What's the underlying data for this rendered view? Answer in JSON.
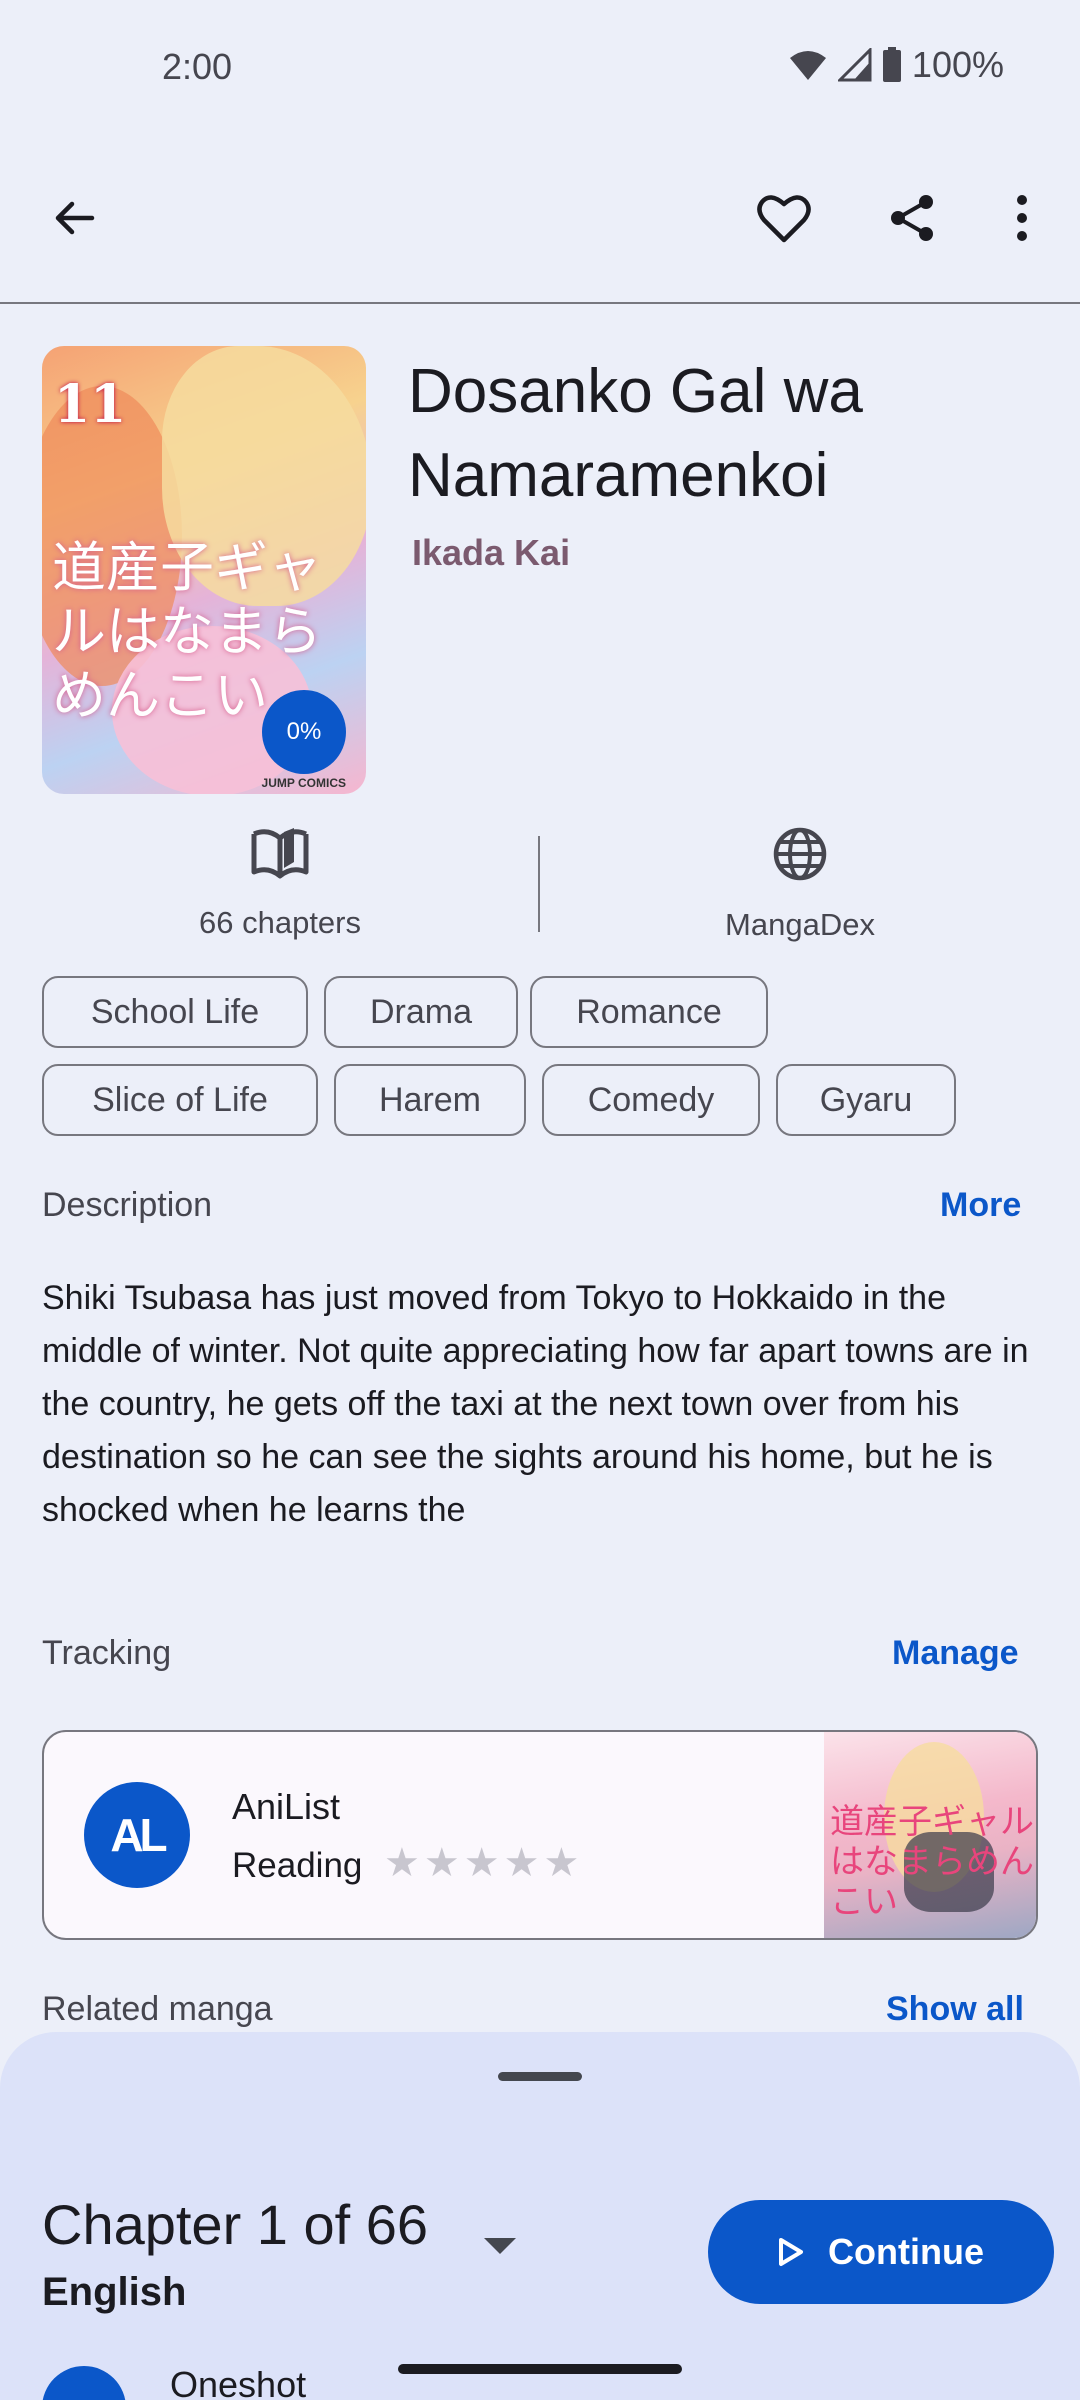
{
  "status_bar": {
    "time": "2:00",
    "battery": "100%"
  },
  "manga": {
    "title": "Dosanko Gal wa Namaramenkoi",
    "author": "Ikada Kai",
    "progress": "0%",
    "chapters_label": "66 chapters",
    "source": "MangaDex"
  },
  "genres": [
    "School Life",
    "Drama",
    "Romance",
    "Slice of Life",
    "Harem",
    "Comedy",
    "Gyaru"
  ],
  "description": {
    "heading": "Description",
    "more_label": "More",
    "text": "Shiki Tsubasa has just moved from Tokyo to Hokkaido in the middle of winter. Not quite appreciating how far apart towns are in the country, he gets off the taxi at the next town over from his destination so he can see the sights around his home, but he is shocked when he learns the"
  },
  "tracking": {
    "heading": "Tracking",
    "manage_label": "Manage",
    "service": "AniList",
    "logo_text": "AL",
    "status": "Reading",
    "rating": 0,
    "max_rating": 5
  },
  "related": {
    "heading": "Related manga",
    "show_all_label": "Show all"
  },
  "sheet": {
    "chapter_label": "Chapter 1 of 66",
    "language": "English",
    "continue_label": "Continue",
    "next_item": "Oneshot"
  },
  "colors": {
    "accent": "#0B57C9",
    "background": "#ECEFF9",
    "sheet": "#DCE2F9",
    "author": "#7B5A6F"
  },
  "icons": [
    "back-arrow-icon",
    "heart-icon",
    "share-icon",
    "more-vert-icon",
    "book-icon",
    "globe-icon",
    "play-icon",
    "star-icon",
    "wifi-icon",
    "signal-icon",
    "battery-icon"
  ]
}
